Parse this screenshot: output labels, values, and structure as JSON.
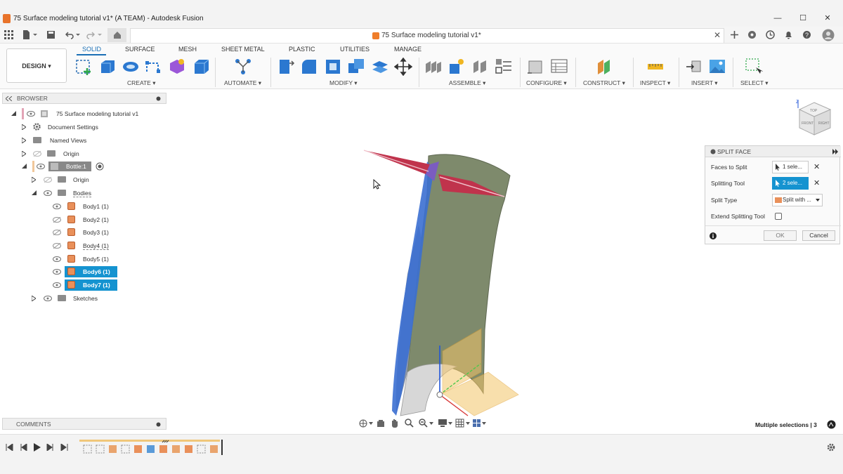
{
  "window": {
    "title": "75 Surface modeling tutorial v1* (A TEAM) - Autodesk Fusion",
    "doc_tab": "75 Surface modeling tutorial v1*",
    "controls": [
      "—",
      "☐",
      "✕"
    ]
  },
  "ribbon": {
    "workspace": "DESIGN ▾",
    "tabs": [
      "SOLID",
      "SURFACE",
      "MESH",
      "SHEET METAL",
      "PLASTIC",
      "UTILITIES",
      "MANAGE"
    ],
    "active_tab": "SOLID",
    "groups": [
      "CREATE ▾",
      "AUTOMATE ▾",
      "MODIFY ▾",
      "ASSEMBLE ▾",
      "CONFIGURE ▾",
      "CONSTRUCT ▾",
      "INSPECT ▾",
      "INSERT ▾",
      "SELECT ▾"
    ]
  },
  "browser": {
    "title": "BROWSER",
    "rows": [
      {
        "label": "75 Surface modeling tutorial v1"
      },
      {
        "label": "Document Settings"
      },
      {
        "label": "Named Views"
      },
      {
        "label": "Origin"
      },
      {
        "label": "Bottle:1"
      },
      {
        "label": "Origin"
      },
      {
        "label": "Bodies"
      },
      {
        "label": "Body1 (1)"
      },
      {
        "label": "Body2 (1)"
      },
      {
        "label": "Body3 (1)"
      },
      {
        "label": "Body4 (1)"
      },
      {
        "label": "Body5 (1)"
      },
      {
        "label": "Body6 (1)"
      },
      {
        "label": "Body7 (1)"
      },
      {
        "label": "Sketches"
      }
    ]
  },
  "split_face": {
    "title": "SPLIT FACE",
    "faces_to_split_label": "Faces to Split",
    "faces_to_split_value": "1 sele...",
    "splitting_tool_label": "Splitting Tool",
    "splitting_tool_value": "2 sele...",
    "split_type_label": "Split Type",
    "split_type_value": "Split with ...",
    "extend_label": "Extend Splitting Tool",
    "ok": "OK",
    "cancel": "Cancel"
  },
  "comments": {
    "title": "COMMENTS"
  },
  "status": {
    "selection": "Multiple selections | 3"
  },
  "viewcube": {
    "top": "TOP",
    "front": "FRONT",
    "right": "RIGHT"
  },
  "colors": {
    "accent": "#1593d0",
    "active_tab": "#1a6fb5",
    "body_green": "#7e8a6c",
    "face_red": "#c0334c",
    "face_blue": "#3b6fd1"
  }
}
